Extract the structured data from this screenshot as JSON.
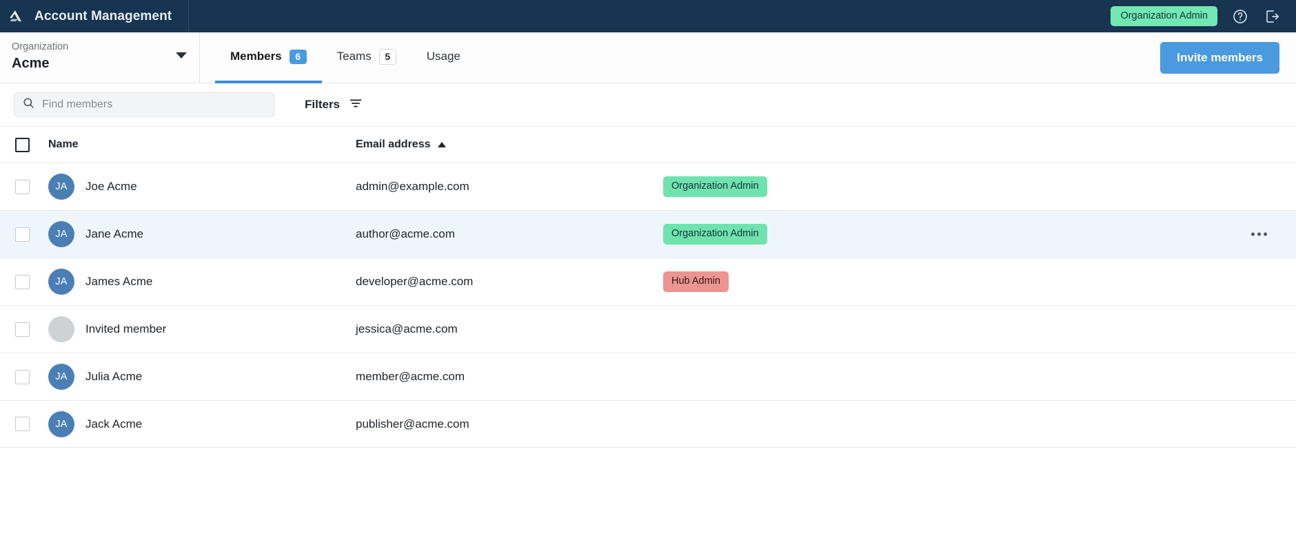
{
  "header": {
    "logo_icon": "triangle-logo-icon",
    "title": "Account Management",
    "role_badge": "Organization Admin",
    "help_icon": "help-circle-icon",
    "logout_icon": "logout-icon"
  },
  "org_selector": {
    "label": "Organization",
    "name": "Acme",
    "caret_icon": "chevron-down-icon"
  },
  "tabs": [
    {
      "label": "Members",
      "count": "6",
      "active": true
    },
    {
      "label": "Teams",
      "count": "5",
      "active": false
    },
    {
      "label": "Usage",
      "count": "",
      "active": false
    }
  ],
  "actions": {
    "invite_members": "Invite members"
  },
  "toolbar": {
    "search_placeholder": "Find members",
    "search_value": "",
    "search_icon": "search-icon",
    "filters_label": "Filters",
    "filters_icon": "filter-icon"
  },
  "table": {
    "columns": {
      "name": "Name",
      "email": "Email address"
    },
    "sort": {
      "column": "Email address",
      "direction": "asc",
      "icon": "sort-ascending-icon"
    },
    "rows": [
      {
        "initials": "JA",
        "name": "Joe Acme",
        "email": "admin@example.com",
        "role": "Organization Admin",
        "role_type": "org",
        "highlight": false,
        "has_avatar": true,
        "menu": false
      },
      {
        "initials": "JA",
        "name": "Jane Acme",
        "email": "author@acme.com",
        "role": "Organization Admin",
        "role_type": "org",
        "highlight": true,
        "has_avatar": true,
        "menu": true
      },
      {
        "initials": "JA",
        "name": "James Acme",
        "email": "developer@acme.com",
        "role": "Hub Admin",
        "role_type": "hub",
        "highlight": false,
        "has_avatar": true,
        "menu": false
      },
      {
        "initials": "",
        "name": "Invited member",
        "email": "jessica@acme.com",
        "role": "",
        "role_type": "none",
        "highlight": false,
        "has_avatar": false,
        "menu": false
      },
      {
        "initials": "JA",
        "name": "Julia Acme",
        "email": "member@acme.com",
        "role": "",
        "role_type": "none",
        "highlight": false,
        "has_avatar": true,
        "menu": false
      },
      {
        "initials": "JA",
        "name": "Jack Acme",
        "email": "publisher@acme.com",
        "role": "",
        "role_type": "none",
        "highlight": false,
        "has_avatar": true,
        "menu": false
      }
    ]
  },
  "colors": {
    "header_bg": "#173450",
    "accent_blue": "#4a9ae0",
    "badge_green": "#6fe3ad",
    "badge_red": "#ec9490",
    "avatar_blue": "#4a7fb5",
    "row_highlight": "#eff6fb"
  }
}
